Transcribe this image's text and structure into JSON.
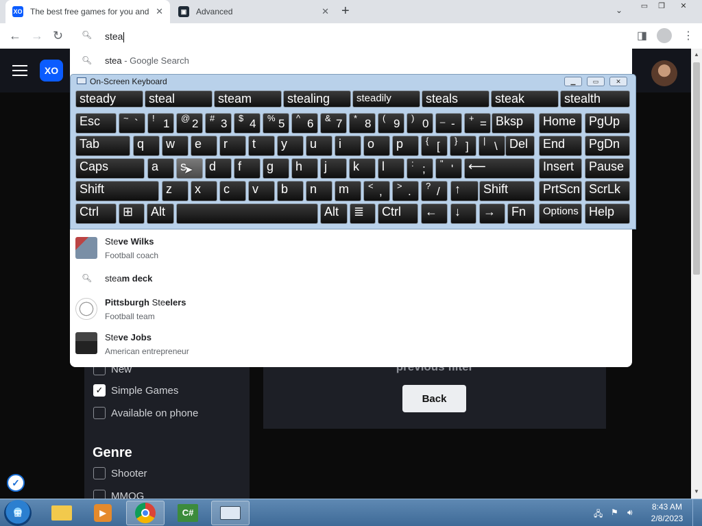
{
  "browser": {
    "tabs": [
      {
        "title": "The best free games for you and",
        "active": true,
        "favicon": "xo-logo-icon"
      },
      {
        "title": "Advanced",
        "active": false,
        "favicon": "brand-icon"
      }
    ],
    "new_tab_symbol": "+",
    "tab_close_symbol": "✕",
    "tab_search_symbol": "⌄",
    "window_controls": [
      "▭",
      "❐",
      "✕"
    ],
    "omnibox_value": "stea"
  },
  "site": {
    "logo_text": "XO",
    "filters": [
      {
        "label": "New",
        "checked": false
      },
      {
        "label": "Simple Games",
        "checked": true
      },
      {
        "label": "Available on phone",
        "checked": false
      }
    ],
    "genre_title": "Genre",
    "genres": [
      {
        "label": "Shooter",
        "checked": false
      },
      {
        "label": "MMOG",
        "checked": false
      }
    ],
    "previous_filter_text": "previous filter",
    "back_label": "Back"
  },
  "suggestions": {
    "google_search": {
      "query": "stea",
      "suffix": " - Google Search"
    },
    "steve_wilks": {
      "match": "Ste",
      "rest": "ve Wilks",
      "subtitle": "Football coach"
    },
    "steam_deck": {
      "match": "stea",
      "rest": "m deck"
    },
    "steelers": {
      "prefix": "Pittsburgh ",
      "match": "Ste",
      "rest": "elers",
      "subtitle": "Football team"
    },
    "steve_jobs": {
      "match": "Ste",
      "rest": "ve Jobs",
      "subtitle": "American entrepreneur"
    }
  },
  "osk": {
    "title": "On-Screen Keyboard",
    "predictions": [
      "steady",
      "steal",
      "steam",
      "stealing",
      "steadily",
      "steals",
      "steak",
      "stealth"
    ],
    "keys": {
      "esc": "Esc",
      "bksp": "Bksp",
      "home": "Home",
      "pgup": "PgUp",
      "tab": "Tab",
      "del": "Del",
      "end": "End",
      "pgdn": "PgDn",
      "caps": "Caps",
      "insert": "Insert",
      "pause": "Pause",
      "shift": "Shift",
      "prtscn": "PrtScn",
      "scrlk": "ScrLk",
      "ctrl": "Ctrl",
      "alt": "Alt",
      "fn": "Fn",
      "options": "Options",
      "help": "Help",
      "row_num": [
        [
          "~",
          "`"
        ],
        [
          "!",
          "1"
        ],
        [
          "@",
          "2"
        ],
        [
          "#",
          "3"
        ],
        [
          "$",
          "4"
        ],
        [
          "%",
          "5"
        ],
        [
          "^",
          "6"
        ],
        [
          "&",
          "7"
        ],
        [
          "*",
          "8"
        ],
        [
          "(",
          "9"
        ],
        [
          ")",
          "0"
        ],
        [
          "_",
          "-"
        ],
        [
          "+",
          "="
        ]
      ],
      "row_q": [
        "q",
        "w",
        "e",
        "r",
        "t",
        "y",
        "u",
        "i",
        "o",
        "p"
      ],
      "row_q_sym": [
        [
          "{",
          "["
        ],
        [
          "}",
          "]"
        ],
        [
          "|",
          "\\"
        ]
      ],
      "row_a": [
        "a",
        "s",
        "d",
        "f",
        "g",
        "h",
        "j",
        "k",
        "l"
      ],
      "row_a_sym": [
        [
          ":",
          ";"
        ],
        [
          "\"",
          "'"
        ]
      ],
      "row_z": [
        "z",
        "x",
        "c",
        "v",
        "b",
        "n",
        "m"
      ],
      "row_z_sym": [
        [
          "<",
          ","
        ],
        [
          ">",
          "."
        ],
        [
          "?",
          "/"
        ]
      ],
      "arrows": [
        "↑",
        "←",
        "↓",
        "→"
      ],
      "enter_symbol": "⟵"
    }
  },
  "taskbar": {
    "time": "8:43 AM",
    "date": "2/8/2023"
  }
}
